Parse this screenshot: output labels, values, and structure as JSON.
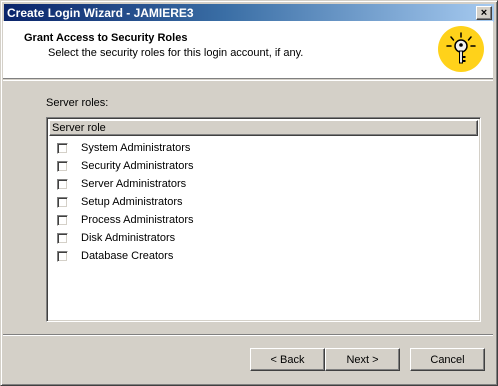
{
  "window": {
    "title": "Create Login Wizard - JAMIERE3",
    "close_label": "×"
  },
  "header": {
    "title": "Grant Access to Security Roles",
    "subtitle": "Select the security roles for this login account, if any.",
    "icon": "key-icon"
  },
  "roles": {
    "label": "Server roles:",
    "column_header": "Server role",
    "items": [
      {
        "label": "System Administrators",
        "checked": false
      },
      {
        "label": "Security Administrators",
        "checked": false
      },
      {
        "label": "Server Administrators",
        "checked": false
      },
      {
        "label": "Setup Administrators",
        "checked": false
      },
      {
        "label": "Process Administrators",
        "checked": false
      },
      {
        "label": "Disk Administrators",
        "checked": false
      },
      {
        "label": "Database Creators",
        "checked": false
      }
    ]
  },
  "buttons": {
    "back": "< Back",
    "next": "Next >",
    "cancel": "Cancel"
  },
  "colors": {
    "title_bar_start": "#0a246a",
    "title_bar_end": "#a6caf0",
    "face": "#d4d0c8",
    "icon_bg": "#ffd21a"
  }
}
